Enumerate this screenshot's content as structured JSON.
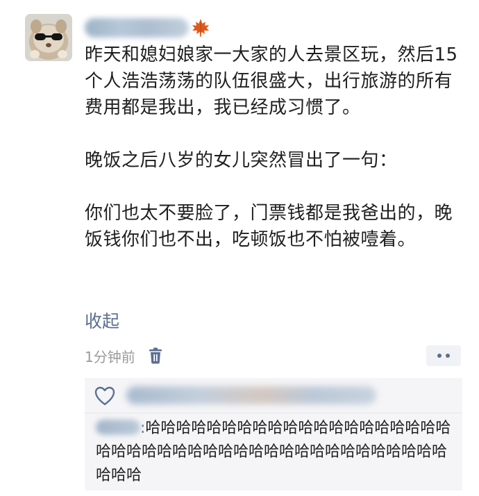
{
  "post": {
    "author_hidden": true,
    "paragraphs": [
      "昨天和媳妇娘家一大家的人去景区玩，然后15个人浩浩荡荡的队伍很盛大，出行旅游的所有费用都是我出，我已经成习惯了。",
      "晚饭之后八岁的女儿突然冒出了一句：",
      "你们也太不要脸了，门票钱都是我爸出的，晚饭钱你们也不出，吃顿饭也不怕被噎着。"
    ],
    "collapse_label": "收起",
    "timestamp": "1分钟前"
  },
  "icons": {
    "leaf": "maple-leaf-icon",
    "delete": "trash-icon",
    "more": "more-dots-icon",
    "like": "heart-outline-icon"
  },
  "interactions": {
    "comment": {
      "separator": ":",
      "text": "哈哈哈哈哈哈哈哈哈哈哈哈哈哈哈哈哈哈哈哈哈哈哈哈哈哈哈哈哈哈哈哈哈哈哈哈哈哈哈哈哈哈哈哈哈哈"
    }
  },
  "colors": {
    "link": "#5b6f92",
    "meta": "#9a9a9a",
    "panel": "#f5f5f7"
  }
}
